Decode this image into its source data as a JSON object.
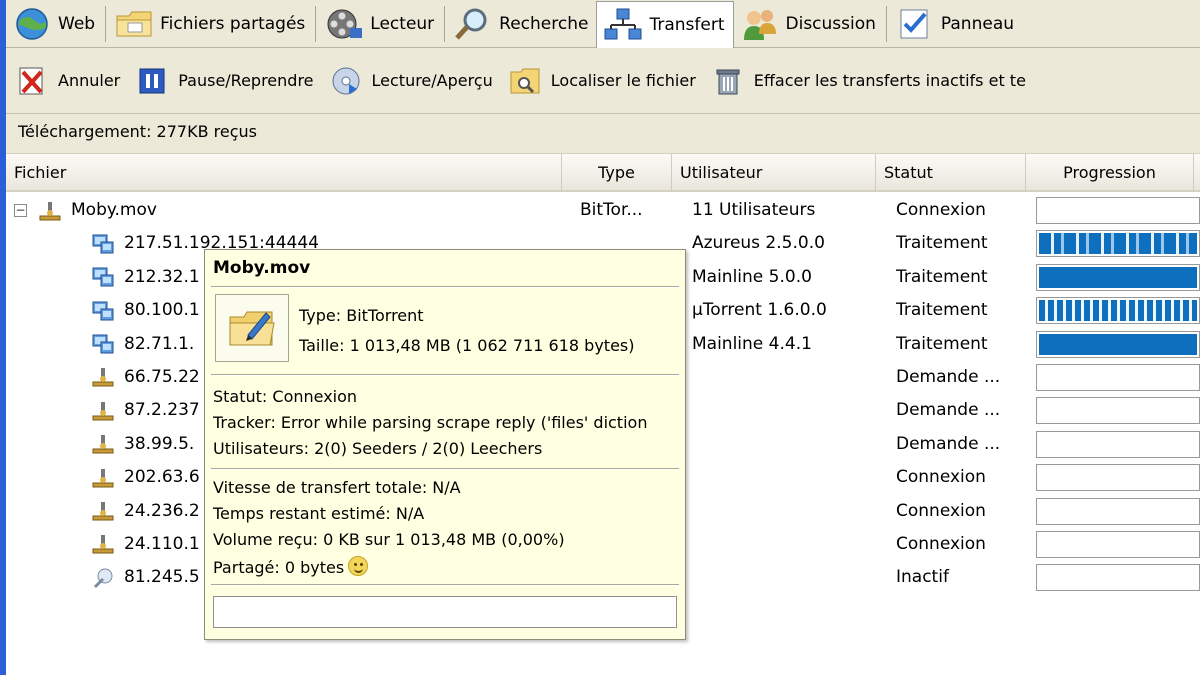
{
  "tabs": [
    {
      "label": "Web",
      "icon": "globe-icon"
    },
    {
      "label": "Fichiers partagés",
      "icon": "shared-folder-icon"
    },
    {
      "label": "Lecteur",
      "icon": "film-reel-icon"
    },
    {
      "label": "Recherche",
      "icon": "magnifier-icon"
    },
    {
      "label": "Transfert",
      "icon": "network-transfer-icon",
      "active": true
    },
    {
      "label": "Discussion",
      "icon": "chat-people-icon"
    },
    {
      "label": "Panneau",
      "icon": "control-panel-icon"
    }
  ],
  "toolbar": {
    "cancel_label": "Annuler",
    "pause_label": "Pause/Reprendre",
    "play_label": "Lecture/Aperçu",
    "locate_label": "Localiser le fichier",
    "clear_label": "Effacer les transferts inactifs et te"
  },
  "status_line": "Téléchargement: 277KB reçus",
  "columns": {
    "file": "Fichier",
    "type": "Type",
    "user": "Utilisateur",
    "status": "Statut",
    "progress": "Progression"
  },
  "parent_row": {
    "file": "Moby.mov",
    "type": "BitTor...",
    "user": "11 Utilisateurs",
    "status": "Connexion",
    "progress": 0
  },
  "peers": [
    {
      "file": "217.51.192.151:44444",
      "user": "Azureus 2.5.0.0",
      "status": "Traitement",
      "icon": "peer-computer-icon",
      "progress_style": "stripes"
    },
    {
      "file": "212.32.1",
      "user": "Mainline 5.0.0",
      "status": "Traitement",
      "icon": "peer-computer-icon",
      "progress_style": "solid"
    },
    {
      "file": "80.100.1",
      "user": "µTorrent 1.6.0.0",
      "status": "Traitement",
      "icon": "peer-computer-icon",
      "progress_style": "dense-stripes"
    },
    {
      "file": "82.71.1.",
      "user": "Mainline 4.4.1",
      "status": "Traitement",
      "icon": "peer-computer-icon",
      "progress_style": "solid"
    },
    {
      "file": "66.75.22",
      "user": "",
      "status": "Demande ...",
      "icon": "peer-connecting-icon",
      "progress_style": "empty"
    },
    {
      "file": "87.2.237",
      "user": "",
      "status": "Demande ...",
      "icon": "peer-connecting-icon",
      "progress_style": "empty"
    },
    {
      "file": "38.99.5.",
      "user": "",
      "status": "Demande ...",
      "icon": "peer-connecting-icon",
      "progress_style": "empty"
    },
    {
      "file": "202.63.6",
      "user": "",
      "status": "Connexion",
      "icon": "peer-connecting-icon",
      "progress_style": "empty"
    },
    {
      "file": "24.236.2",
      "user": "",
      "status": "Connexion",
      "icon": "peer-connecting-icon",
      "progress_style": "empty"
    },
    {
      "file": "24.110.1",
      "user": "",
      "status": "Connexion",
      "icon": "peer-connecting-icon",
      "progress_style": "empty"
    },
    {
      "file": "81.245.5",
      "user": "",
      "status": "Inactif",
      "icon": "peer-inactive-icon",
      "progress_style": "empty"
    }
  ],
  "tooltip": {
    "title": "Moby.mov",
    "type": "Type: BitTorrent",
    "size": "Taille: 1 013,48 MB  (1 062 711 618 bytes)",
    "status": "Statut: Connexion",
    "tracker": "Tracker: Error while parsing scrape reply ('files' diction",
    "users": "Utilisateurs: 2(0) Seeders / 2(0) Leechers",
    "speed": "Vitesse de transfert totale: N/A",
    "eta": "Temps restant estimé: N/A",
    "received": "Volume reçu: 0 KB sur 1 013,48 MB (0,00%)",
    "shared": "Partagé: 0 bytes",
    "progress": 0
  },
  "colors": {
    "progress_fill": "#0d6fbe",
    "tooltip_bg": "#ffffe1",
    "toolbar_bg": "#ece9d8"
  }
}
